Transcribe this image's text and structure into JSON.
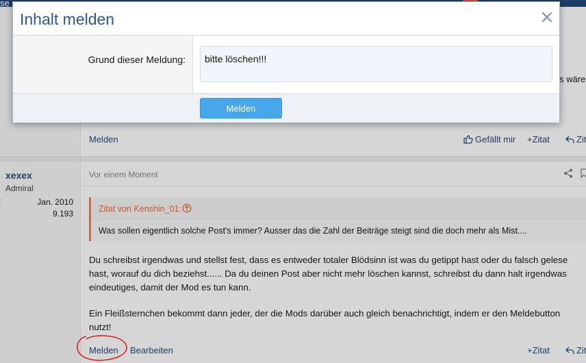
{
  "topbar": {
    "fragment": "se"
  },
  "previous_post": {
    "clipped_text": "s wären",
    "actions": {
      "report": "Melden",
      "like": "Gefällt mir",
      "quote": "Zitat",
      "reply": "Zit"
    }
  },
  "post": {
    "user": {
      "name": "xexex",
      "title": "Admiral",
      "joined": "Jan. 2010",
      "post_count": "9.193"
    },
    "date": "Vor einem Moment",
    "quote": {
      "header": "Zitat von Kenshin_01:",
      "text": "Was sollen eigentlich solche Post's immer? Ausser das die Zahl der Beiträge steigt sind die doch mehr als Mist...."
    },
    "body_lines": [
      "Du schreibst irgendwas und stellst fest, dass es entweder totaler Blödsinn ist was du getippt hast oder du falsch gelese",
      "hast, worauf du dich beziehst...... Da du deinen Post aber nicht mehr löschen kannst, schreibst du dann halt irgendwas",
      "eindeutiges, damit der Mod es tun kann.",
      "Ein Fleißsternchen bekommt dann jeder, der die Mods darüber auch gleich benachrichtigt, indem er den Meldebutton",
      "nutzt!"
    ],
    "actions": {
      "report": "Melden",
      "edit": "Bearbeiten",
      "quote": "Zitat",
      "reply": "Zit"
    }
  },
  "modal": {
    "title": "Inhalt melden",
    "label": "Grund dieser Meldung:",
    "reason_value": "bitte löschen!!!",
    "submit_label": "Melden"
  },
  "colors": {
    "accent": "#47a7eb",
    "link": "#1d3d64",
    "quote_border": "#c86c3d",
    "annotation": "#e02020"
  }
}
